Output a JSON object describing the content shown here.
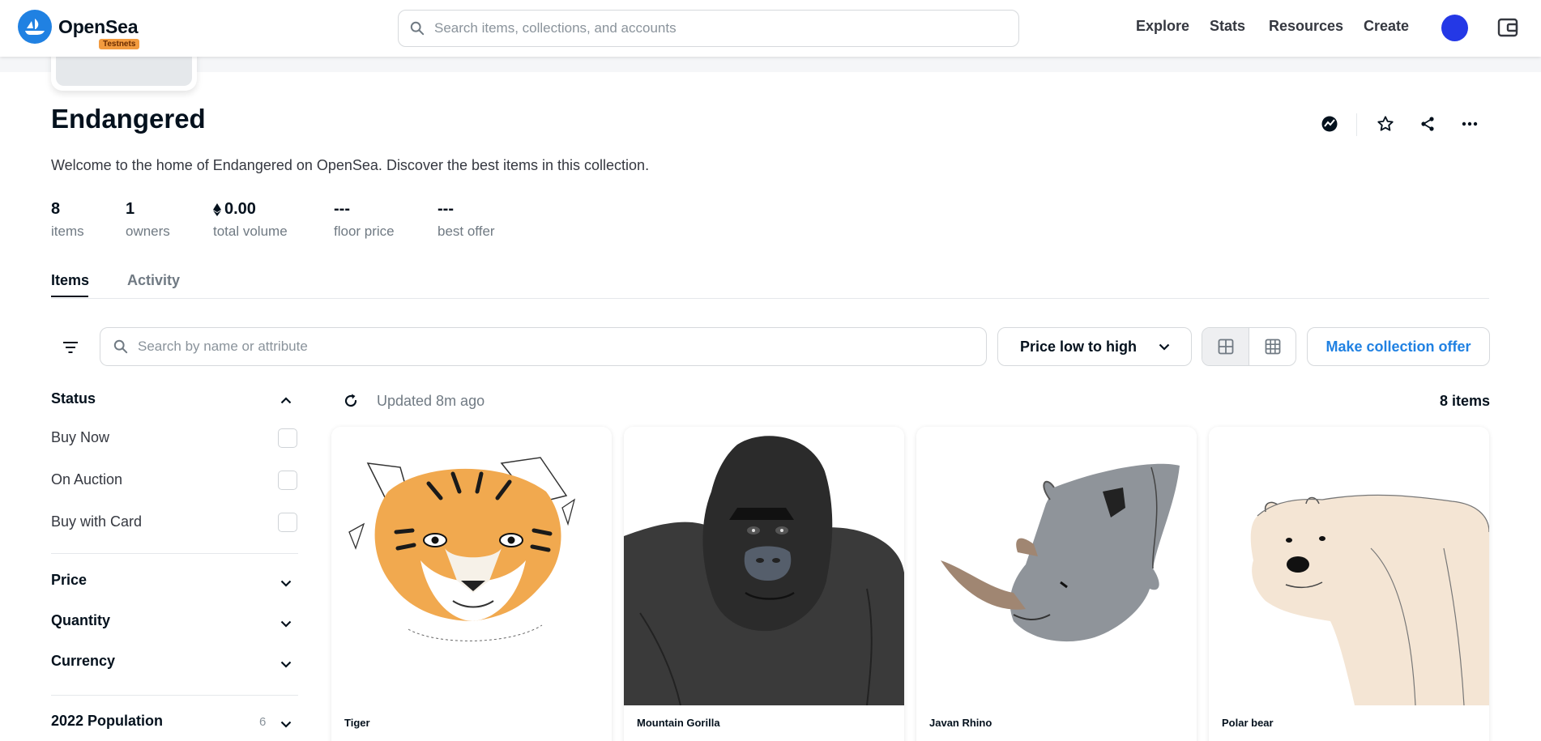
{
  "header": {
    "brand": "OpenSea",
    "badge": "Testnets",
    "search_placeholder": "Search items, collections, and accounts",
    "nav": [
      "Explore",
      "Stats",
      "Resources",
      "Create"
    ]
  },
  "collection": {
    "title": "Endangered",
    "description": "Welcome to the home of Endangered on OpenSea. Discover the best items in this collection.",
    "stats": [
      {
        "value": "8",
        "label": "items"
      },
      {
        "value": "1",
        "label": "owners"
      },
      {
        "value": "0.00",
        "label": "total volume"
      },
      {
        "value": "---",
        "label": "floor price"
      },
      {
        "value": "---",
        "label": "best offer"
      }
    ]
  },
  "tabs": [
    "Items",
    "Activity"
  ],
  "toolbar": {
    "search_placeholder": "Search by name or attribute",
    "sort_label": "Price low to high",
    "offer_label": "Make collection offer"
  },
  "sidebar": {
    "status": "Status",
    "options": [
      "Buy Now",
      "On Auction",
      "Buy with Card"
    ],
    "price": "Price",
    "quantity": "Quantity",
    "currency": "Currency",
    "population": "2022 Population",
    "population_count": "6"
  },
  "results": {
    "updated": "Updated 8m ago",
    "count": "8 items",
    "items": [
      {
        "name": "Tiger"
      },
      {
        "name": "Mountain Gorilla"
      },
      {
        "name": "Javan Rhino"
      },
      {
        "name": "Polar bear"
      }
    ]
  },
  "colors": {
    "accent": "#2081e2",
    "avatar": "#2438e6",
    "badge": "#f29b3f"
  }
}
